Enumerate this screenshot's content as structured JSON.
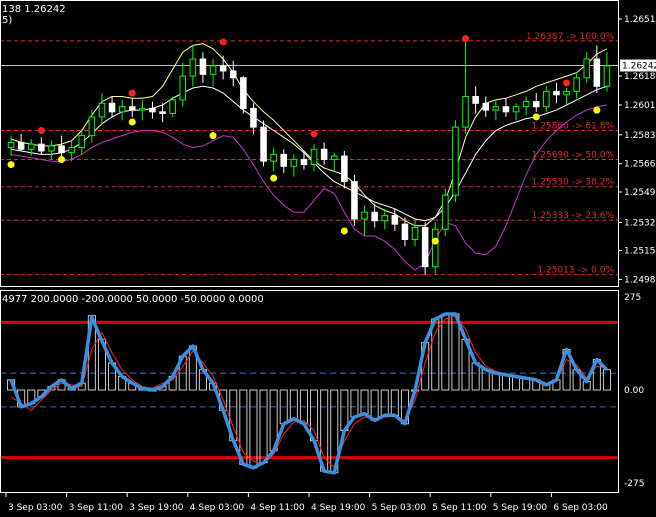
{
  "chart_data": [
    {
      "type": "candlestick",
      "title": "138 1.26242",
      "subtitle": "5)",
      "last_price": "1.26242",
      "last_value": 1.26242,
      "ylim": [
        1.2497,
        1.2658
      ],
      "price_ticks": [
        {
          "label": "1.26515",
          "value": 1.26515
        },
        {
          "label": "1.26180",
          "value": 1.2618
        },
        {
          "label": "1.26010",
          "value": 1.2601
        },
        {
          "label": "1.25835",
          "value": 1.25835
        },
        {
          "label": "1.25665",
          "value": 1.25665
        },
        {
          "label": "1.25499",
          "value": 1.25499
        },
        {
          "label": "1.25320",
          "value": 1.2532
        },
        {
          "label": "1.25155",
          "value": 1.25155
        },
        {
          "label": "1.24985",
          "value": 1.24985
        }
      ],
      "fibonacci_levels": [
        {
          "label": "1.26387 -> 100.0%",
          "value": 1.26387
        },
        {
          "label": "1.25860 -> 61.8%",
          "value": 1.2586
        },
        {
          "label": "1.25690 -> 50.0%",
          "value": 1.2569
        },
        {
          "label": "1.25530 -> 38.2%",
          "value": 1.2553
        },
        {
          "label": "1.25333 -> 23.6%",
          "value": 1.25333
        },
        {
          "label": "1.25013 -> 0.0%",
          "value": 1.25013
        }
      ],
      "candles": [
        [
          1.2576,
          1.2583,
          1.2571,
          1.2579
        ],
        [
          1.2579,
          1.2584,
          1.2574,
          1.2575
        ],
        [
          1.2575,
          1.2581,
          1.2571,
          1.2578
        ],
        [
          1.2578,
          1.2582,
          1.2572,
          1.2574
        ],
        [
          1.2574,
          1.258,
          1.2569,
          1.2577
        ],
        [
          1.2577,
          1.2583,
          1.2571,
          1.2573
        ],
        [
          1.2573,
          1.258,
          1.2568,
          1.2576
        ],
        [
          1.2576,
          1.2586,
          1.2572,
          1.2583
        ],
        [
          1.2583,
          1.2598,
          1.2579,
          1.2594
        ],
        [
          1.2594,
          1.2608,
          1.259,
          1.2602
        ],
        [
          1.2602,
          1.2606,
          1.2594,
          1.2597
        ],
        [
          1.2597,
          1.2604,
          1.2592,
          1.26
        ],
        [
          1.26,
          1.2605,
          1.2594,
          1.2598
        ],
        [
          1.2598,
          1.2604,
          1.2592,
          1.2599
        ],
        [
          1.2599,
          1.2603,
          1.2593,
          1.2597
        ],
        [
          1.2597,
          1.2602,
          1.2591,
          1.2596
        ],
        [
          1.2596,
          1.2606,
          1.2594,
          1.2604
        ],
        [
          1.2604,
          1.2626,
          1.26,
          1.2618
        ],
        [
          1.2618,
          1.2636,
          1.2612,
          1.2628
        ],
        [
          1.2628,
          1.2632,
          1.2614,
          1.2619
        ],
        [
          1.2619,
          1.2628,
          1.2612,
          1.2624
        ],
        [
          1.2624,
          1.263,
          1.2616,
          1.2621
        ],
        [
          1.2621,
          1.2627,
          1.2612,
          1.2617
        ],
        [
          1.2617,
          1.2618,
          1.2596,
          1.2599
        ],
        [
          1.2599,
          1.2602,
          1.2584,
          1.2588
        ],
        [
          1.2588,
          1.2592,
          1.2565,
          1.2568
        ],
        [
          1.2568,
          1.2576,
          1.2562,
          1.2572
        ],
        [
          1.2572,
          1.2575,
          1.2561,
          1.2565
        ],
        [
          1.2565,
          1.2572,
          1.2559,
          1.2569
        ],
        [
          1.2569,
          1.2574,
          1.2563,
          1.2566
        ],
        [
          1.2566,
          1.2578,
          1.2562,
          1.2575
        ],
        [
          1.2575,
          1.2579,
          1.2566,
          1.2569
        ],
        [
          1.2569,
          1.2573,
          1.2562,
          1.2571
        ],
        [
          1.2571,
          1.2574,
          1.2552,
          1.2556
        ],
        [
          1.2556,
          1.256,
          1.253,
          1.2534
        ],
        [
          1.2534,
          1.2542,
          1.2524,
          1.2538
        ],
        [
          1.2538,
          1.2543,
          1.2529,
          1.2533
        ],
        [
          1.2533,
          1.254,
          1.2528,
          1.2536
        ],
        [
          1.2536,
          1.254,
          1.2527,
          1.2531
        ],
        [
          1.2531,
          1.2535,
          1.2518,
          1.2522
        ],
        [
          1.2522,
          1.2533,
          1.2518,
          1.2529
        ],
        [
          1.2529,
          1.2532,
          1.2501,
          1.2506
        ],
        [
          1.2506,
          1.2532,
          1.2502,
          1.2528
        ],
        [
          1.2528,
          1.2552,
          1.2524,
          1.2548
        ],
        [
          1.2548,
          1.2592,
          1.2544,
          1.2588
        ],
        [
          1.2588,
          1.2639,
          1.2584,
          1.2606
        ],
        [
          1.2606,
          1.2612,
          1.2596,
          1.2602
        ],
        [
          1.2602,
          1.2606,
          1.2594,
          1.2598
        ],
        [
          1.2598,
          1.2604,
          1.2592,
          1.26
        ],
        [
          1.26,
          1.2605,
          1.2594,
          1.2597
        ],
        [
          1.2597,
          1.2602,
          1.2592,
          1.26
        ],
        [
          1.26,
          1.2606,
          1.2595,
          1.2603
        ],
        [
          1.2603,
          1.2608,
          1.2597,
          1.26
        ],
        [
          1.26,
          1.2612,
          1.2597,
          1.2609
        ],
        [
          1.2609,
          1.2614,
          1.2602,
          1.2607
        ],
        [
          1.2607,
          1.2611,
          1.2601,
          1.2609
        ],
        [
          1.2609,
          1.262,
          1.2605,
          1.2617
        ],
        [
          1.2617,
          1.2632,
          1.2614,
          1.2628
        ],
        [
          1.2628,
          1.2636,
          1.2608,
          1.2612
        ],
        [
          1.2612,
          1.2632,
          1.2609,
          1.2624
        ]
      ],
      "ma_yellow": [
        1.2581,
        1.2579,
        1.2578,
        1.2577,
        1.2577,
        1.2578,
        1.258,
        1.2586,
        1.2595,
        1.2603,
        1.2606,
        1.2606,
        1.2605,
        1.2605,
        1.2606,
        1.2612,
        1.2622,
        1.2632,
        1.2636,
        1.2637,
        1.2634,
        1.2628,
        1.262,
        1.261,
        1.2603,
        1.2597,
        1.2592,
        1.2586,
        1.258,
        1.2574,
        1.2568,
        1.2564,
        1.2562,
        1.256,
        1.2555,
        1.2548,
        1.2542,
        1.2539,
        1.2537,
        1.2533,
        1.253,
        1.253,
        1.2535,
        1.2545,
        1.2562,
        1.2582,
        1.2594,
        1.2602,
        1.2604,
        1.2605,
        1.2607,
        1.2609,
        1.2612,
        1.2614,
        1.2616,
        1.2618,
        1.262,
        1.2625,
        1.2631,
        1.2634
      ],
      "ma_white": [
        1.2575,
        1.2574,
        1.2573,
        1.2572,
        1.2572,
        1.2573,
        1.2575,
        1.2579,
        1.2584,
        1.259,
        1.2594,
        1.2597,
        1.2598,
        1.2598,
        1.2599,
        1.2601,
        1.2605,
        1.2608,
        1.2611,
        1.2612,
        1.2611,
        1.2608,
        1.2603,
        1.2598,
        1.2594,
        1.259,
        1.2586,
        1.2582,
        1.2578,
        1.2573,
        1.2567,
        1.2561,
        1.2556,
        1.2553,
        1.255,
        1.2547,
        1.2544,
        1.2542,
        1.254,
        1.2537,
        1.2534,
        1.2533,
        1.2535,
        1.2541,
        1.255,
        1.2561,
        1.2572,
        1.258,
        1.2586,
        1.2589,
        1.2591,
        1.2593,
        1.2594,
        1.2596,
        1.2598,
        1.2601,
        1.2604,
        1.2607,
        1.261,
        1.2612
      ],
      "ma_magenta": [
        1.2572,
        1.2571,
        1.257,
        1.2569,
        1.2568,
        1.2568,
        1.2569,
        1.2572,
        1.2576,
        1.2579,
        1.2581,
        1.2583,
        1.2585,
        1.2586,
        1.2586,
        1.2585,
        1.2582,
        1.2578,
        1.2576,
        1.2577,
        1.258,
        1.2583,
        1.2582,
        1.2575,
        1.2566,
        1.2556,
        1.2548,
        1.2542,
        1.2538,
        1.2538,
        1.2545,
        1.2552,
        1.2549,
        1.2538,
        1.2528,
        1.2524,
        1.2524,
        1.2521,
        1.2516,
        1.2509,
        1.2504,
        1.2508,
        1.2522,
        1.2532,
        1.253,
        1.252,
        1.2514,
        1.2513,
        1.2518,
        1.253,
        1.2545,
        1.256,
        1.2572,
        1.258,
        1.2586,
        1.2591,
        1.2595,
        1.2598,
        1.26,
        1.2601
      ],
      "dots_red": [
        [
          3,
          1.2586
        ],
        [
          12,
          1.2608
        ],
        [
          21,
          1.2638
        ],
        [
          30,
          1.2584
        ],
        [
          45,
          1.264
        ],
        [
          55,
          1.2614
        ]
      ],
      "dots_yellow": [
        [
          0,
          1.2566
        ],
        [
          5,
          1.2569
        ],
        [
          12,
          1.2591
        ],
        [
          20,
          1.2583
        ],
        [
          26,
          1.2558
        ],
        [
          33,
          1.2527
        ],
        [
          42,
          1.2521
        ],
        [
          52,
          1.2594
        ],
        [
          58,
          1.2598
        ]
      ]
    },
    {
      "type": "histogram",
      "title": "4977 200.0000 -200.0000 50.0000 -50.0000 0.0000",
      "ylim": [
        -290,
        290
      ],
      "y_ticks": [
        {
          "label": "275",
          "value": 275
        },
        {
          "label": "0.00",
          "value": 0
        },
        {
          "label": "-275",
          "value": -275
        }
      ],
      "levels": [
        200,
        -200,
        50,
        -50,
        0
      ],
      "histogram": [
        30,
        -50,
        -40,
        -20,
        10,
        30,
        5,
        20,
        220,
        150,
        80,
        40,
        20,
        5,
        0,
        10,
        40,
        100,
        130,
        60,
        20,
        -60,
        -150,
        -220,
        -230,
        -215,
        -180,
        -100,
        -85,
        -100,
        -150,
        -240,
        -245,
        -120,
        -80,
        -70,
        -90,
        -75,
        -75,
        -100,
        0,
        140,
        210,
        225,
        225,
        150,
        80,
        60,
        50,
        45,
        40,
        35,
        30,
        15,
        30,
        120,
        60,
        25,
        90,
        60
      ],
      "blue_line": [
        30,
        -50,
        -40,
        -20,
        10,
        30,
        5,
        20,
        215,
        145,
        80,
        40,
        20,
        5,
        0,
        10,
        40,
        100,
        130,
        60,
        20,
        -60,
        -150,
        -220,
        -230,
        -215,
        -180,
        -100,
        -85,
        -100,
        -150,
        -240,
        -245,
        -120,
        -80,
        -70,
        -90,
        -75,
        -75,
        -100,
        0,
        140,
        210,
        225,
        225,
        150,
        80,
        60,
        50,
        45,
        40,
        35,
        30,
        15,
        30,
        120,
        60,
        25,
        90,
        60
      ],
      "red_line": [
        -20,
        -40,
        -60,
        -30,
        0,
        20,
        15,
        10,
        120,
        170,
        110,
        60,
        30,
        10,
        5,
        20,
        30,
        70,
        115,
        80,
        40,
        -30,
        -110,
        -185,
        -210,
        -220,
        -190,
        -130,
        -95,
        -90,
        -120,
        -200,
        -230,
        -150,
        -100,
        -80,
        -85,
        -80,
        -78,
        -90,
        -30,
        80,
        170,
        210,
        220,
        180,
        110,
        70,
        55,
        48,
        42,
        38,
        32,
        20,
        25,
        90,
        75,
        35,
        70,
        65
      ]
    }
  ],
  "x_axis": {
    "labels": [
      "3 Sep 03:00",
      "3 Sep 11:00",
      "3 Sep 19:00",
      "4 Sep 03:00",
      "4 Sep 11:00",
      "4 Sep 19:00",
      "5 Sep 03:00",
      "5 Sep 11:00",
      "5 Sep 19:00",
      "6 Sep 03:00"
    ],
    "positions": [
      0,
      6,
      12,
      18,
      24,
      30,
      36,
      42,
      48,
      54
    ]
  },
  "colors": {
    "background": "#000000",
    "bull_candle": "#00ff00",
    "bear_candle": "#ffffff",
    "fibonacci": "#e22a2a",
    "ma_yellow": "#ffffa0",
    "ma_white": "#ffffff",
    "ma_magenta": "#cc33cc",
    "dot_red": "#ff2020",
    "dot_yellow": "#ffff00",
    "histogram": "#c8c8c8",
    "cci_blue": "#3a8fe0",
    "cci_red": "#ff2020",
    "level_red": "#e00000",
    "level_blue": "#3a6fd0",
    "axis_text": "#ffffff"
  }
}
